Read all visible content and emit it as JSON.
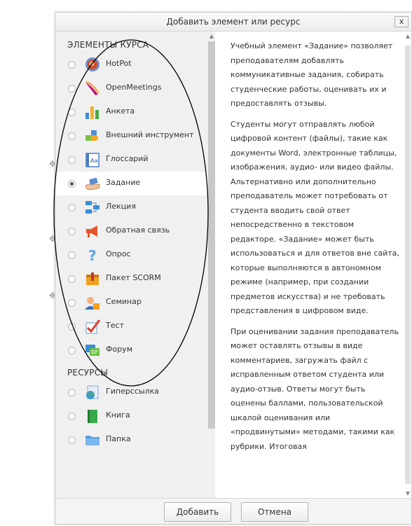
{
  "dialog": {
    "title": "Добавить элемент или ресурс",
    "close_label": "x"
  },
  "sections": {
    "activities": "ЭЛЕМЕНТЫ КУРСА",
    "resources": "РЕСУРСЫ"
  },
  "activities": [
    {
      "label": "HotPot",
      "icon": "hotpot-icon",
      "selected": false
    },
    {
      "label": "OpenMeetings",
      "icon": "openmeetings-icon",
      "selected": false
    },
    {
      "label": "Анкета",
      "icon": "survey-icon",
      "selected": false
    },
    {
      "label": "Внешний инструмент",
      "icon": "external-tool-icon",
      "selected": false
    },
    {
      "label": "Глоссарий",
      "icon": "glossary-icon",
      "selected": false
    },
    {
      "label": "Задание",
      "icon": "assignment-icon",
      "selected": true
    },
    {
      "label": "Лекция",
      "icon": "lesson-icon",
      "selected": false
    },
    {
      "label": "Обратная связь",
      "icon": "feedback-icon",
      "selected": false
    },
    {
      "label": "Опрос",
      "icon": "choice-icon",
      "selected": false
    },
    {
      "label": "Пакет SCORM",
      "icon": "scorm-icon",
      "selected": false
    },
    {
      "label": "Семинар",
      "icon": "workshop-icon",
      "selected": false
    },
    {
      "label": "Тест",
      "icon": "quiz-icon",
      "selected": false
    },
    {
      "label": "Форум",
      "icon": "forum-icon",
      "selected": false
    }
  ],
  "resources": [
    {
      "label": "Гиперссылка",
      "icon": "url-icon",
      "selected": false
    },
    {
      "label": "Книга",
      "icon": "book-icon",
      "selected": false
    },
    {
      "label": "Папка",
      "icon": "folder-icon",
      "selected": false
    }
  ],
  "help": {
    "paragraphs": [
      "Учебный элемент «Задание» позволяет преподавателям добавлять коммуникативные задания, собирать студенческие работы, оценивать их и предоставлять отзывы.",
      "Студенты могут отправлять любой цифровой контент (файлы), такие как документы Word, электронные таблицы, изображения, аудио- или видео файлы. Альтернативно или дополнительно преподаватель может потребовать от студента вводить свой ответ непосредственно в текстовом редакторе. «Задание» может быть использоваться и для ответов вне сайта, которые выполняются в автономном режиме (например, при создании предметов искусства) и не требовать представления в цифровом виде.",
      "При оценивании задания преподаватель может оставлять отзывы в виде комментариев, загружать файл с исправленным ответом студента или аудио-отзыв. Ответы могут быть оценены баллами, пользовательской шкалой оценивания или «продвинутыми» методами, такими как рубрики. Итоговая"
    ]
  },
  "footer": {
    "add_label": "Добавить",
    "cancel_label": "Отмена"
  },
  "colors": {
    "pane_bg": "#f0f0f0",
    "selected_bg": "#ffffff",
    "text": "#333333"
  }
}
